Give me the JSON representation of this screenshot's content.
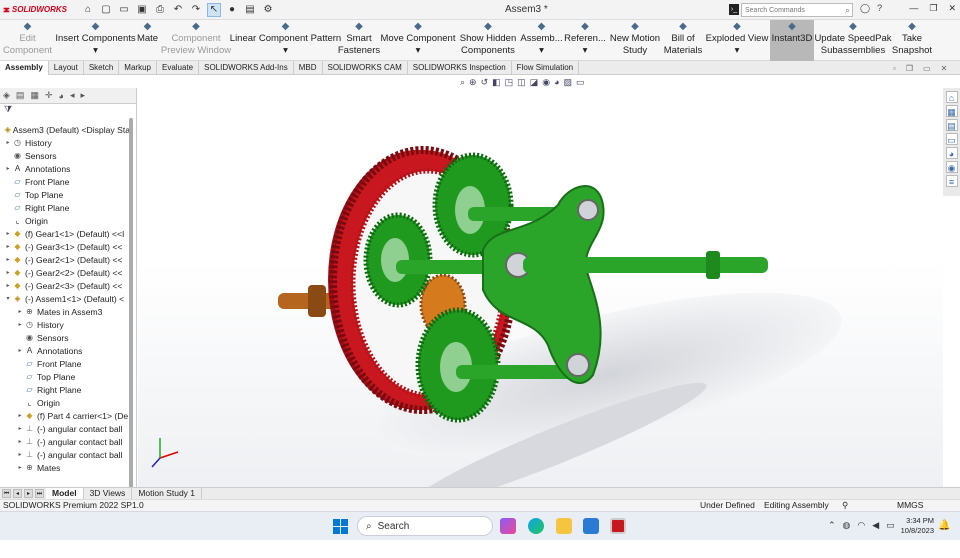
{
  "app": {
    "logo": "SOLIDWORKS",
    "doc_title": "Assem3 *"
  },
  "search": {
    "placeholder": "Search Commands"
  },
  "commands": [
    {
      "label": "Edit\nComponent",
      "icon": "edit-component-icon",
      "disabled": true
    },
    {
      "label": "Insert Components\n▾",
      "icon": "insert-components-icon"
    },
    {
      "label": "Mate\n ",
      "icon": "mate-icon"
    },
    {
      "label": "Component\nPreview Window",
      "icon": "component-preview-icon",
      "disabled": true
    },
    {
      "label": "Linear Component Pattern\n▾",
      "icon": "linear-pattern-icon"
    },
    {
      "label": "Smart\nFasteners",
      "icon": "smart-fasteners-icon"
    },
    {
      "label": "Move Component\n▾",
      "icon": "move-component-icon"
    },
    {
      "label": "Show Hidden\nComponents",
      "icon": "show-hidden-icon"
    },
    {
      "label": "Assemb...\n▾",
      "icon": "assembly-features-icon"
    },
    {
      "label": "Referen...\n▾",
      "icon": "reference-geometry-icon"
    },
    {
      "label": "New Motion\nStudy",
      "icon": "motion-study-icon"
    },
    {
      "label": "Bill of\nMaterials",
      "icon": "bom-icon"
    },
    {
      "label": "Exploded View\n▾",
      "icon": "exploded-view-icon"
    },
    {
      "label": "Instant3D\n ",
      "icon": "instant3d-icon",
      "active": true
    },
    {
      "label": "Update SpeedPak\nSubassemblies",
      "icon": "speedpak-icon"
    },
    {
      "label": "Take\nSnapshot",
      "icon": "snapshot-icon"
    }
  ],
  "tabs": [
    "Assembly",
    "Layout",
    "Sketch",
    "Markup",
    "Evaluate",
    "SOLIDWORKS Add-Ins",
    "MBD",
    "SOLIDWORKS CAM",
    "SOLIDWORKS Inspection",
    "Flow Simulation"
  ],
  "active_tab": "Assembly",
  "tree": {
    "nodes": [
      {
        "label": "Assem3 (Default) <Display Sta",
        "level": 0,
        "arrow": "",
        "icon": "assembly"
      },
      {
        "label": "History",
        "level": 1,
        "arrow": "▸",
        "icon": "history"
      },
      {
        "label": "Sensors",
        "level": 1,
        "arrow": "",
        "icon": "sensors"
      },
      {
        "label": "Annotations",
        "level": 1,
        "arrow": "▸",
        "icon": "annotations"
      },
      {
        "label": "Front Plane",
        "level": 1,
        "arrow": "",
        "icon": "plane"
      },
      {
        "label": "Top Plane",
        "level": 1,
        "arrow": "",
        "icon": "plane"
      },
      {
        "label": "Right Plane",
        "level": 1,
        "arrow": "",
        "icon": "plane"
      },
      {
        "label": "Origin",
        "level": 1,
        "arrow": "",
        "icon": "origin"
      },
      {
        "label": "(f) Gear1<1> (Default) <<I",
        "level": 1,
        "arrow": "▸",
        "icon": "part"
      },
      {
        "label": "(-) Gear3<1> (Default) <<",
        "level": 1,
        "arrow": "▸",
        "icon": "part"
      },
      {
        "label": "(-) Gear2<1> (Default) <<",
        "level": 1,
        "arrow": "▸",
        "icon": "part"
      },
      {
        "label": "(-) Gear2<2> (Default) <<",
        "level": 1,
        "arrow": "▸",
        "icon": "part"
      },
      {
        "label": "(-) Gear2<3> (Default) <<",
        "level": 1,
        "arrow": "▸",
        "icon": "part"
      },
      {
        "label": "(-) Assem1<1> (Default) <",
        "level": 1,
        "arrow": "▾",
        "icon": "assembly"
      },
      {
        "label": "Mates in Assem3",
        "level": 2,
        "arrow": "▸",
        "icon": "mates"
      },
      {
        "label": "History",
        "level": 2,
        "arrow": "▸",
        "icon": "history"
      },
      {
        "label": "Sensors",
        "level": 2,
        "arrow": "",
        "icon": "sensors"
      },
      {
        "label": "Annotations",
        "level": 2,
        "arrow": "▸",
        "icon": "annotations"
      },
      {
        "label": "Front Plane",
        "level": 2,
        "arrow": "",
        "icon": "plane"
      },
      {
        "label": "Top Plane",
        "level": 2,
        "arrow": "",
        "icon": "plane"
      },
      {
        "label": "Right Plane",
        "level": 2,
        "arrow": "",
        "icon": "plane"
      },
      {
        "label": "Origin",
        "level": 2,
        "arrow": "",
        "icon": "origin"
      },
      {
        "label": "(f) Part 4 carrier<1> (De",
        "level": 2,
        "arrow": "▸",
        "icon": "part"
      },
      {
        "label": "(-) angular contact ball",
        "level": 2,
        "arrow": "▸",
        "icon": "bearing"
      },
      {
        "label": "(-) angular contact ball",
        "level": 2,
        "arrow": "▸",
        "icon": "bearing"
      },
      {
        "label": "(-) angular contact ball",
        "level": 2,
        "arrow": "▸",
        "icon": "bearing"
      },
      {
        "label": "Mates",
        "level": 2,
        "arrow": "▸",
        "icon": "mates"
      }
    ]
  },
  "bottom_tabs": [
    "Model",
    "3D Views",
    "Motion Study 1"
  ],
  "active_bottom_tab": "Model",
  "status": {
    "product": "SOLIDWORKS Premium 2022 SP1.0",
    "state": "Under Defined",
    "mode": "Editing Assembly",
    "units": "MMGS"
  },
  "taskbar": {
    "search_label": "Search",
    "time": "3:34 PM",
    "date": "10/8/2023"
  },
  "colors": {
    "ring_gear": "#c8171e",
    "planet_gears": "#1f9a1f",
    "carrier": "#2aa52a",
    "shaft": "#b5651d",
    "accent": "#0078d4"
  }
}
